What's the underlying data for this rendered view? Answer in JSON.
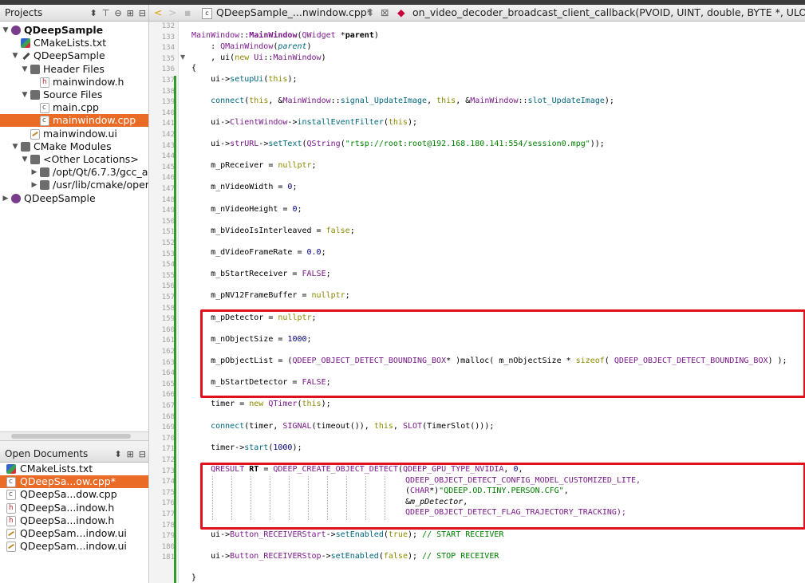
{
  "projects_pane": {
    "title": "Projects",
    "tree": [
      {
        "label": "QDeepSample",
        "icon": "project-icon",
        "bold": true,
        "expanded": true
      },
      {
        "label": "CMakeLists.txt",
        "icon": "cmake-icon"
      },
      {
        "label": "QDeepSample",
        "icon": "build-target-icon",
        "expanded": true
      },
      {
        "label": "Header Files",
        "icon": "folder-icon",
        "expanded": true
      },
      {
        "label": "mainwindow.h",
        "icon": "header-file-icon"
      },
      {
        "label": "Source Files",
        "icon": "folder-icon",
        "expanded": true
      },
      {
        "label": "main.cpp",
        "icon": "cpp-file-icon"
      },
      {
        "label": "mainwindow.cpp",
        "icon": "cpp-file-icon",
        "selected": true
      },
      {
        "label": "mainwindow.ui",
        "icon": "ui-file-icon"
      },
      {
        "label": "CMake Modules",
        "icon": "folder-icon",
        "expanded": true
      },
      {
        "label": "<Other Locations>",
        "icon": "folder-icon",
        "expanded": true
      },
      {
        "label": "/opt/Qt/6.7.3/gcc_a",
        "icon": "folder-icon"
      },
      {
        "label": "/usr/lib/cmake/oper",
        "icon": "folder-icon"
      },
      {
        "label": "QDeepSample",
        "icon": "project-icon"
      }
    ]
  },
  "open_documents": {
    "title": "Open Documents",
    "items": [
      {
        "label": "CMakeLists.txt",
        "icon": "cmake-icon"
      },
      {
        "label": "QDeepSa...ow.cpp*",
        "icon": "cpp-file-icon",
        "selected": true
      },
      {
        "label": "QDeepSa...dow.cpp",
        "icon": "cpp-file-icon"
      },
      {
        "label": "QDeepSa...indow.h",
        "icon": "header-file-icon"
      },
      {
        "label": "QDeepSa...indow.h",
        "icon": "header-file-icon"
      },
      {
        "label": "QDeepSam...indow.ui",
        "icon": "ui-file-icon"
      },
      {
        "label": "QDeepSam...indow.ui",
        "icon": "ui-file-icon"
      }
    ]
  },
  "editor_toolbar": {
    "file_tab": "QDeepSample_...nwindow.cpp*",
    "symbol": "on_video_decoder_broadcast_client_callback(PVOID, UINT, double, BYTE *, ULONG, P"
  },
  "line_numbers": [
    "132",
    "133",
    "134",
    "135",
    "136",
    "137",
    "138",
    "139",
    "140",
    "141",
    "142",
    "143",
    "144",
    "145",
    "146",
    "147",
    "148",
    "149",
    "150",
    "151",
    "152",
    "153",
    "154",
    "155",
    "156",
    "157",
    "158",
    "159",
    "160",
    "161",
    "162",
    "163",
    "164",
    "165",
    "166",
    "167",
    "168",
    "169",
    "170",
    "171",
    "172",
    "173",
    "174",
    "175",
    "176",
    "177",
    "178",
    "179",
    "180",
    "181"
  ],
  "code": {
    "l133_a": "MainWindow",
    "l133_b": "::",
    "l133_c": "MainWindow",
    "l133_d": "(",
    "l133_e": "QWidget",
    "l133_f": " *",
    "l133_g": "parent",
    "l133_h": ")",
    "l134_a": "    : ",
    "l134_b": "QMainWindow",
    "l134_c": "(",
    "l134_d": "parent",
    "l134_e": ")",
    "l135_a": "    , ui(",
    "l135_b": "new",
    "l135_c": " ",
    "l135_d": "Ui",
    "l135_e": "::",
    "l135_f": "MainWindow",
    "l135_g": ")",
    "l136": "{",
    "l137_a": "    ui->",
    "l137_b": "setupUi",
    "l137_c": "(",
    "l137_d": "this",
    "l137_e": ");",
    "l139_a": "    ",
    "l139_b": "connect",
    "l139_c": "(",
    "l139_d": "this",
    "l139_e": ", &",
    "l139_f": "MainWindow",
    "l139_g": "::",
    "l139_h": "signal_UpdateImage",
    "l139_i": ", ",
    "l139_j": "this",
    "l139_k": ", &",
    "l139_l": "MainWindow",
    "l139_m": "::",
    "l139_n": "slot_UpdateImage",
    "l139_o": ");",
    "l141_a": "    ui->",
    "l141_b": "ClientWindow",
    "l141_c": "->",
    "l141_d": "installEventFilter",
    "l141_e": "(",
    "l141_f": "this",
    "l141_g": ");",
    "l143_a": "    ui->",
    "l143_b": "strURL",
    "l143_c": "->",
    "l143_d": "setText",
    "l143_e": "(",
    "l143_f": "QString",
    "l143_g": "(",
    "l143_h": "\"rtsp://root:root@192.168.180.141:554/session0.mpg\"",
    "l143_i": "));",
    "l145_a": "    m_pReceiver = ",
    "l145_b": "nullptr",
    "l145_c": ";",
    "l147_a": "    m_nVideoWidth = ",
    "l147_b": "0",
    "l147_c": ";",
    "l149_a": "    m_nVideoHeight = ",
    "l149_b": "0",
    "l149_c": ";",
    "l151_a": "    m_bVideoIsInterleaved = ",
    "l151_b": "false",
    "l151_c": ";",
    "l153_a": "    m_dVideoFrameRate = ",
    "l153_b": "0.0",
    "l153_c": ";",
    "l155_a": "    m_bStartReceiver = ",
    "l155_b": "FALSE",
    "l155_c": ";",
    "l157_a": "    m_pNV12FrameBuffer = ",
    "l157_b": "nullptr",
    "l157_c": ";",
    "l159_a": "    m_pDetector = ",
    "l159_b": "nullptr",
    "l159_c": ";",
    "l161_a": "    m_nObjectSize = ",
    "l161_b": "1000",
    "l161_c": ";",
    "l163_a": "    m_pObjectList = (",
    "l163_b": "QDEEP_OBJECT_DETECT_BOUNDING_BOX",
    "l163_c": "* )",
    "l163_d": "malloc",
    "l163_e": "( m_nObjectSize * ",
    "l163_f": "sizeof",
    "l163_g": "( ",
    "l163_h": "QDEEP_OBJECT_DETECT_BOUNDING_BOX",
    "l163_i": ") );",
    "l165_a": "    m_bStartDetector = ",
    "l165_b": "FALSE",
    "l165_c": ";",
    "l167_a": "    timer = ",
    "l167_b": "new",
    "l167_c": " ",
    "l167_d": "QTimer",
    "l167_e": "(",
    "l167_f": "this",
    "l167_g": ");",
    "l169_a": "    ",
    "l169_b": "connect",
    "l169_c": "(timer, ",
    "l169_d": "SIGNAL",
    "l169_e": "(timeout()), ",
    "l169_f": "this",
    "l169_g": ", ",
    "l169_h": "SLOT",
    "l169_i": "(TimerSlot()));",
    "l171_a": "    timer->",
    "l171_b": "start",
    "l171_c": "(",
    "l171_d": "1000",
    "l171_e": ");",
    "l173_a": "    ",
    "l173_b": "QRESULT",
    "l173_c": " ",
    "l173_d": "RT",
    "l173_e": " = ",
    "l173_f": "QDEEP_CREATE_OBJECT_DETECT",
    "l173_g": "(",
    "l173_h": "QDEEP_GPU_TYPE_NVIDIA",
    "l173_i": ", ",
    "l173_j": "0",
    "l173_k": ",",
    "l174": "QDEEP_OBJECT_DETECT_CONFIG_MODEL_CUSTOMIZED_LITE,",
    "l175_a": "(",
    "l175_b": "CHAR",
    "l175_c": "*)",
    "l175_d": "\"QDEEP.OD.TINY.PERSON.CFG\"",
    "l175_e": ",",
    "l176_a": "&",
    "l176_b": "m_pDetector",
    "l176_c": ",",
    "l177": "QDEEP_OBJECT_DETECT_FLAG_TRAJECTORY_TRACKING);",
    "l179_a": "    ui->",
    "l179_b": "Button_RECEIVERStart",
    "l179_c": "->",
    "l179_d": "setEnabled",
    "l179_e": "(",
    "l179_f": "true",
    "l179_g": "); ",
    "l179_h": "// START RECEIVER",
    "l181_a": "    ui->",
    "l181_b": "Button_RECEIVERStop",
    "l181_c": "->",
    "l181_d": "setEnabled",
    "l181_e": "(",
    "l181_f": "false",
    "l181_g": "); ",
    "l181_h": "// STOP RECEIVER",
    "l183": "}"
  },
  "colors": {
    "selection": "#ea6b26",
    "highlight_box": "#e0101e",
    "keyword": "#8a8a00",
    "type": "#7a1a8a",
    "function": "#00677c",
    "string": "#008000",
    "number": "#000080"
  }
}
